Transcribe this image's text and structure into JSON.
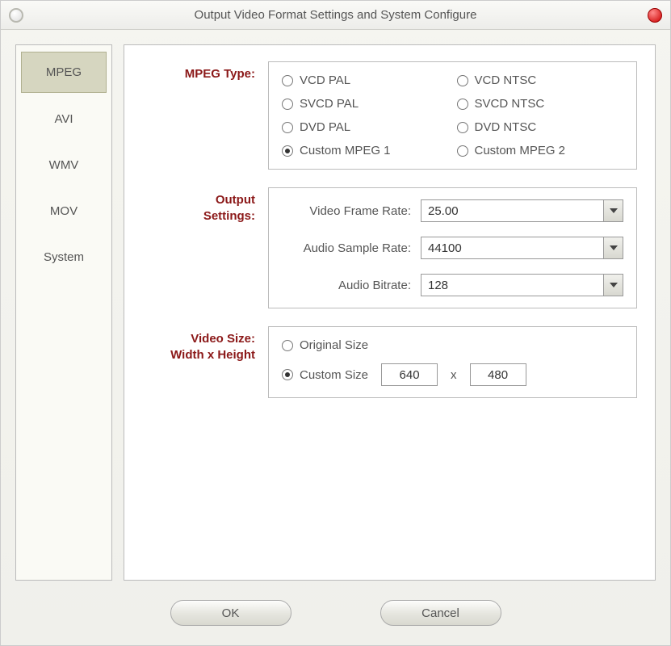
{
  "window": {
    "title": "Output Video Format Settings and System Configure"
  },
  "tabs": [
    {
      "label": "MPEG",
      "selected": true
    },
    {
      "label": "AVI",
      "selected": false
    },
    {
      "label": "WMV",
      "selected": false
    },
    {
      "label": "MOV",
      "selected": false
    },
    {
      "label": "System",
      "selected": false
    }
  ],
  "mpeg_type": {
    "section_label": "MPEG Type:",
    "options": [
      {
        "label": "VCD PAL",
        "checked": false
      },
      {
        "label": "VCD NTSC",
        "checked": false
      },
      {
        "label": "SVCD PAL",
        "checked": false
      },
      {
        "label": "SVCD NTSC",
        "checked": false
      },
      {
        "label": "DVD PAL",
        "checked": false
      },
      {
        "label": "DVD NTSC",
        "checked": false
      },
      {
        "label": "Custom MPEG 1",
        "checked": true
      },
      {
        "label": "Custom MPEG 2",
        "checked": false
      }
    ]
  },
  "output_settings": {
    "section_label": "Output\nSettings:",
    "rows": [
      {
        "label": "Video Frame Rate:",
        "value": "25.00"
      },
      {
        "label": "Audio Sample Rate:",
        "value": "44100"
      },
      {
        "label": "Audio Bitrate:",
        "value": "128"
      }
    ]
  },
  "video_size": {
    "section_label": "Video Size:\nWidth x Height",
    "original_label": "Original Size",
    "custom_label": "Custom Size",
    "selected": "custom",
    "width": "640",
    "height": "480",
    "separator": "x"
  },
  "buttons": {
    "ok": "OK",
    "cancel": "Cancel"
  }
}
